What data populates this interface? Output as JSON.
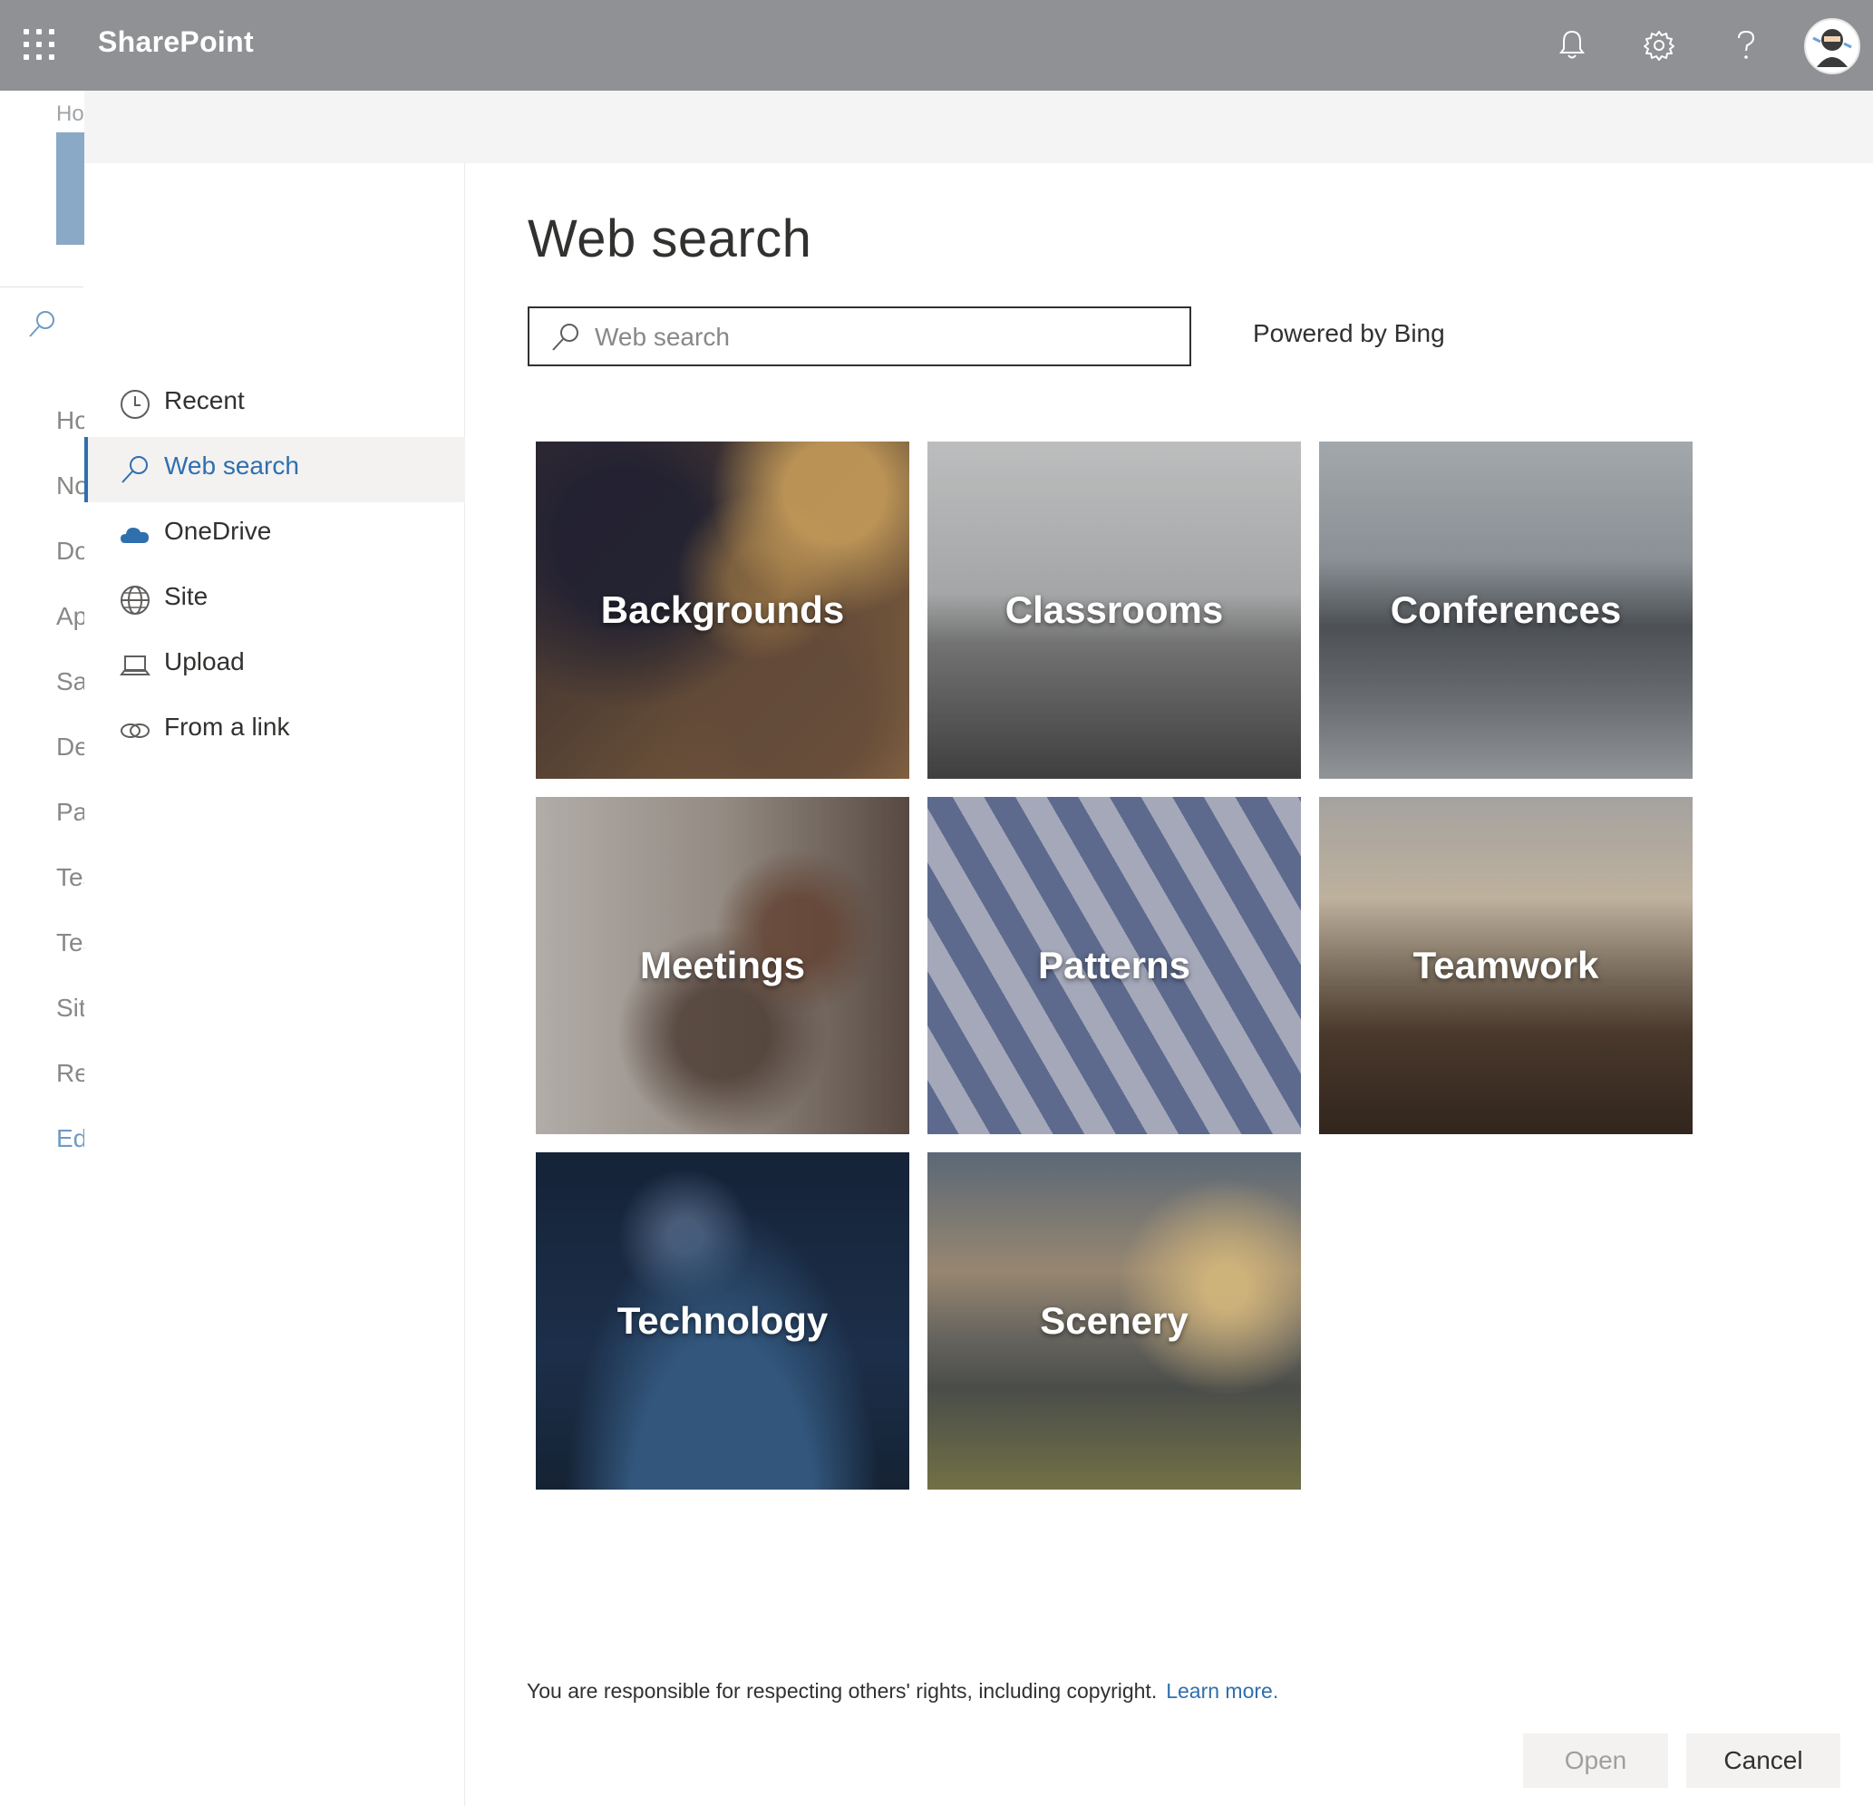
{
  "suitebar": {
    "app_name": "SharePoint",
    "bg_color": "#8f9194",
    "icons": [
      "app-launcher-icon",
      "notifications-bell-icon",
      "settings-gear-icon",
      "help-question-icon",
      "user-avatar"
    ]
  },
  "background_page": {
    "breadcrumb": "Ho",
    "nav": [
      "Ho",
      "No",
      "Do",
      "Ap",
      "Sa",
      "De",
      "Pa",
      "Tes",
      "Tes",
      "Sit",
      "Re",
      "Ed"
    ]
  },
  "panel": {
    "nav_items": [
      {
        "label": "Recent",
        "icon": "clock-icon",
        "active": false
      },
      {
        "label": "Web search",
        "icon": "search-icon",
        "active": true
      },
      {
        "label": "OneDrive",
        "icon": "cloud-icon",
        "active": false
      },
      {
        "label": "Site",
        "icon": "globe-icon",
        "active": false
      },
      {
        "label": "Upload",
        "icon": "laptop-upload-icon",
        "active": false
      },
      {
        "label": "From a link",
        "icon": "link-icon",
        "active": false
      }
    ],
    "title": "Web search",
    "search": {
      "placeholder": "Web search",
      "value": ""
    },
    "powered_by": "Powered by Bing",
    "tiles": [
      {
        "label": "Backgrounds"
      },
      {
        "label": "Classrooms"
      },
      {
        "label": "Conferences"
      },
      {
        "label": "Meetings"
      },
      {
        "label": "Patterns"
      },
      {
        "label": "Teamwork"
      },
      {
        "label": "Technology"
      },
      {
        "label": "Scenery"
      }
    ],
    "notice": "You are responsible for respecting others' rights, including copyright.",
    "learn_more": "Learn more.",
    "open_label": "Open",
    "cancel_label": "Cancel",
    "accent_color": "#2f6fad"
  }
}
